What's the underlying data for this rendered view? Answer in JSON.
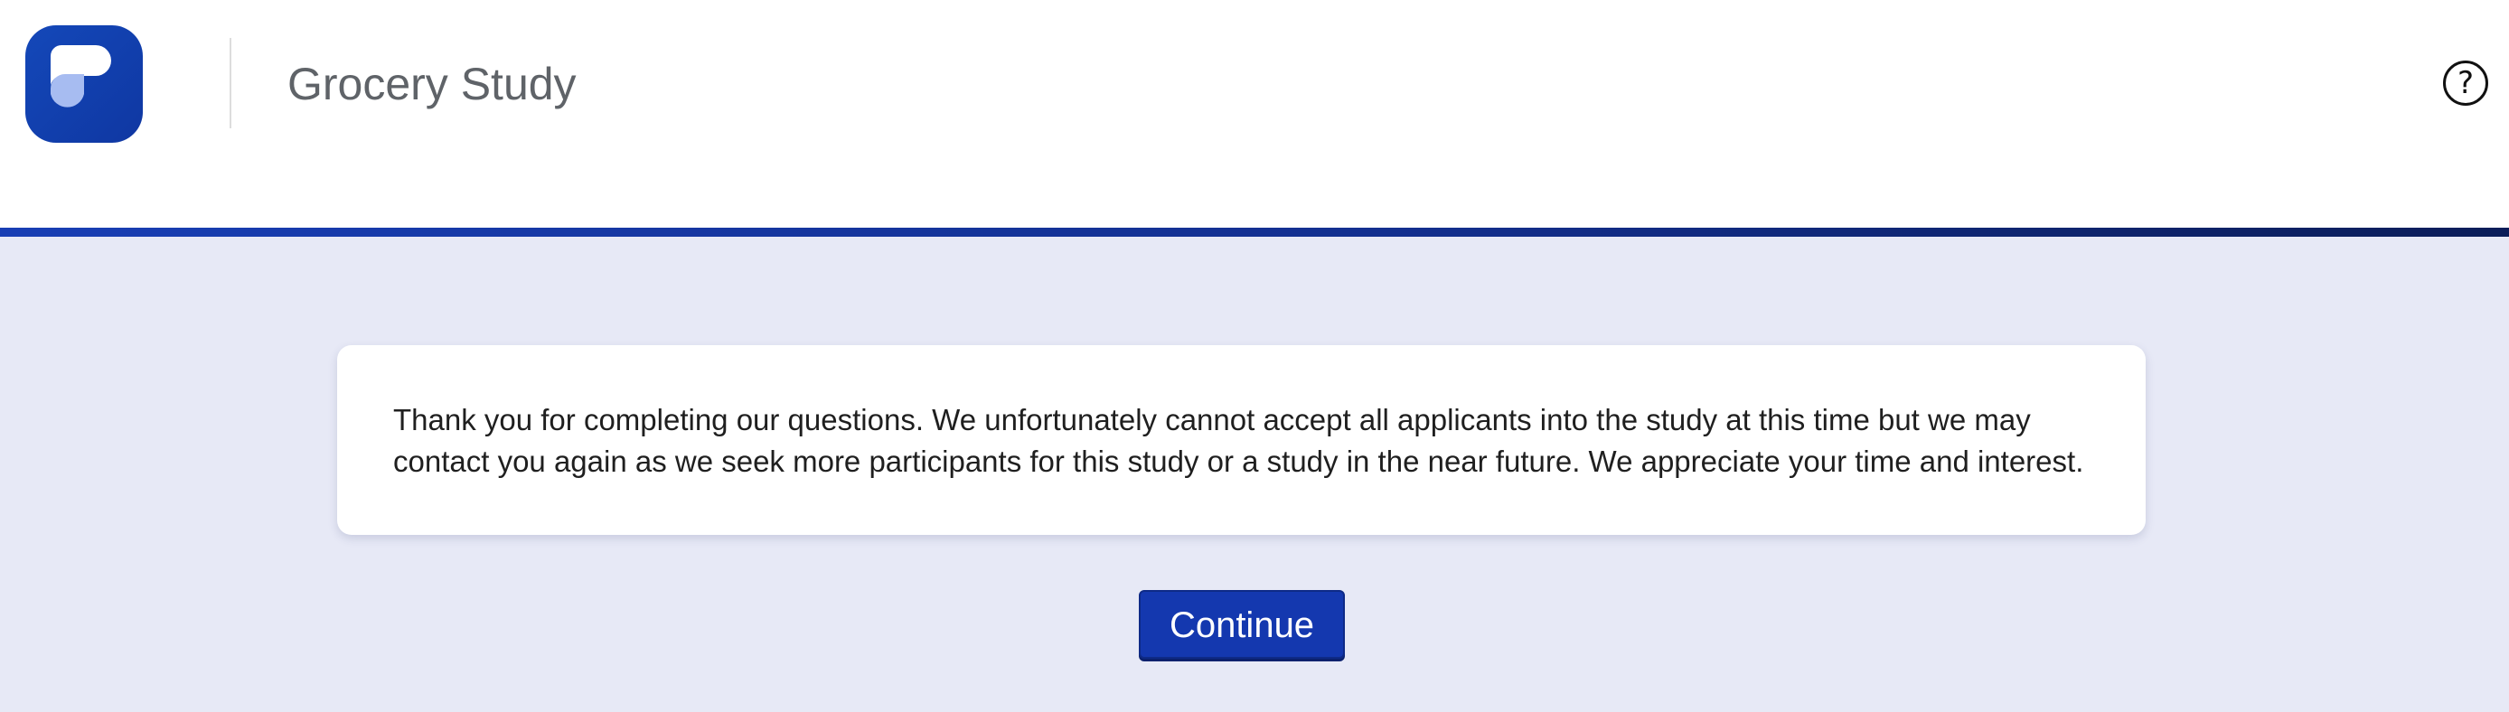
{
  "app": {
    "logo_icon": "prolific-logo-icon",
    "title": "Grocery Study"
  },
  "header": {
    "help_icon": "help-circle-icon",
    "help_glyph": "?"
  },
  "main": {
    "message": "Thank you for completing our questions. We unfortunately cannot accept all applicants into the study at this time but we may contact you again as we seek more participants for this study or a study in the near future. We appreciate your time and interest.",
    "continue_label": "Continue"
  },
  "colors": {
    "brand_blue": "#1438af",
    "background": "#e7e9f6",
    "card": "#ffffff"
  }
}
